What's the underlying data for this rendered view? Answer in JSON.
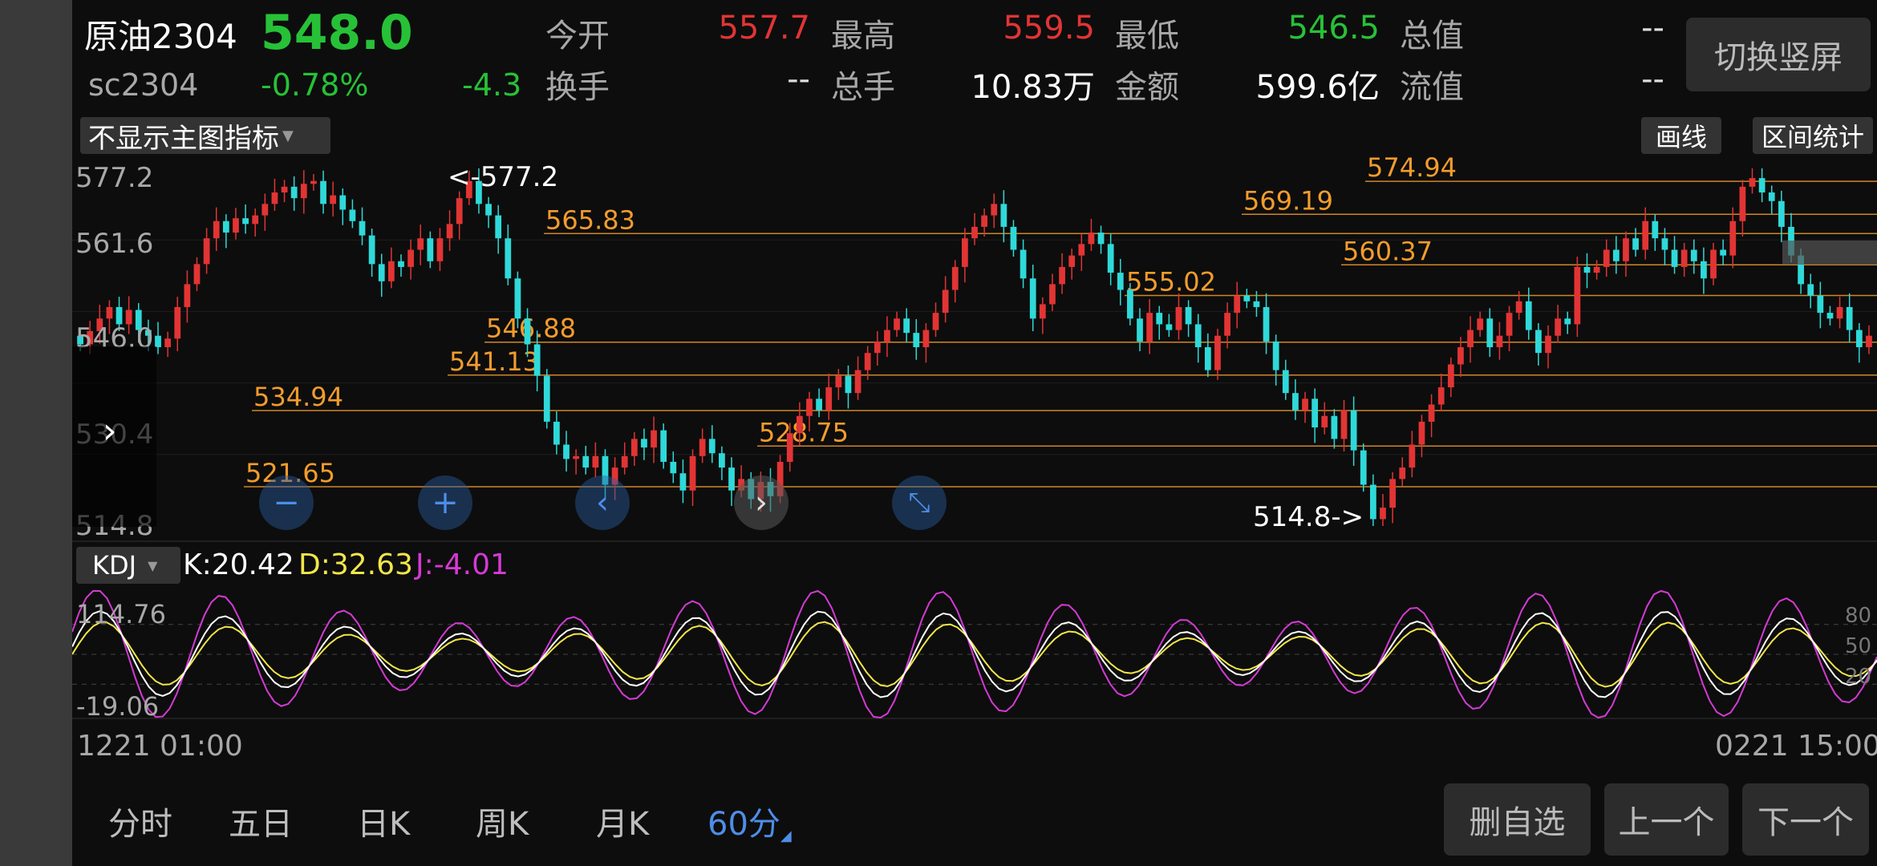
{
  "quote": {
    "name": "原油2304",
    "code": "sc2304",
    "price": "548.0",
    "change_pct": "-0.78%",
    "change": "-4.3",
    "fields": [
      {
        "label": "今开",
        "value": "557.7",
        "color": "#e23434"
      },
      {
        "label": "最高",
        "value": "559.5",
        "color": "#e23434"
      },
      {
        "label": "最低",
        "value": "546.5",
        "color": "#27c137"
      },
      {
        "label": "总值",
        "value": "--",
        "color": "#dddddd"
      },
      {
        "label": "换手",
        "value": "--",
        "color": "#dddddd"
      },
      {
        "label": "总手",
        "value": "10.83万",
        "color": "#ffffff"
      },
      {
        "label": "金额",
        "value": "599.6亿",
        "color": "#ffffff"
      },
      {
        "label": "流值",
        "value": "--",
        "color": "#dddddd"
      }
    ],
    "switch_label": "切换竖屏"
  },
  "toolbar": {
    "indicator_select": "不显示主图指标",
    "draw_line": "画线",
    "range_stats": "区间统计"
  },
  "main_chart": {
    "y_ticks": [
      "577.2",
      "561.6",
      "546.0",
      "530.4",
      "514.8"
    ],
    "high_marker": "<-577.2",
    "low_marker": "514.8->",
    "levels": [
      "574.94",
      "569.19",
      "565.83",
      "560.37",
      "555.02",
      "546.88",
      "541.13",
      "534.94",
      "528.75",
      "521.65"
    ]
  },
  "kdj": {
    "select": "KDJ",
    "k": "K:20.42",
    "d": "D:32.63",
    "j": "J:-4.01",
    "y_top": "114.76",
    "y_bottom": "-19.06",
    "right_ticks": [
      "80",
      "50",
      "20"
    ]
  },
  "time_axis": {
    "start": "1221 01:00",
    "end": "0221 15:00"
  },
  "tabs": [
    "分时",
    "五日",
    "日K",
    "周K",
    "月K",
    "60分"
  ],
  "actions": {
    "delete": "删自选",
    "prev": "上一个",
    "next": "下一个"
  },
  "colors": {
    "up": "#e23434",
    "down": "#2fd9d9",
    "level": "#f39c2c",
    "k": "#ffffff",
    "d": "#f2e64a",
    "j": "#d43ad4",
    "accent": "#4d8ee6"
  },
  "chart_data": {
    "type": "candlestick",
    "ylim": [
      514.8,
      577.2
    ],
    "closes": [
      546.5,
      548.8,
      551.0,
      553.0,
      550.0,
      552.5,
      549.0,
      548.0,
      546.0,
      547.5,
      553.0,
      557.0,
      560.5,
      565.0,
      568.0,
      566.0,
      568.5,
      567.5,
      569.0,
      571.0,
      573.0,
      574.0,
      572.0,
      574.5,
      575.0,
      571.0,
      572.5,
      570.0,
      568.0,
      565.5,
      560.5,
      557.5,
      561.0,
      560.0,
      563.0,
      565.0,
      561.0,
      565.0,
      567.5,
      572.0,
      575.0,
      571.0,
      569.0,
      565.0,
      558.0,
      551.0,
      546.5,
      541.0,
      533.0,
      529.0,
      526.5,
      527.0,
      525.0,
      527.0,
      522.0,
      525.0,
      527.0,
      530.0,
      528.5,
      531.5,
      526.0,
      524.0,
      521.0,
      527.0,
      530.0,
      527.5,
      525.0,
      521.0,
      523.0,
      519.5,
      522.5,
      520.0,
      526.0,
      531.0,
      534.0,
      537.0,
      535.0,
      539.0,
      541.0,
      538.0,
      542.0,
      545.0,
      547.0,
      549.0,
      551.0,
      548.5,
      546.0,
      549.0,
      552.0,
      556.0,
      560.0,
      565.0,
      567.0,
      569.0,
      571.0,
      567.0,
      563.0,
      558.0,
      551.0,
      553.5,
      557.0,
      560.0,
      562.0,
      564.0,
      566.0,
      564.0,
      559.0,
      556.0,
      551.0,
      547.0,
      552.0,
      550.0,
      549.0,
      553.0,
      550.0,
      546.0,
      542.0,
      548.0,
      552.0,
      555.0,
      554.0,
      553.0,
      547.0,
      542.0,
      538.0,
      535.0,
      537.0,
      532.0,
      534.0,
      530.0,
      535.0,
      528.0,
      522.0,
      516.0,
      518.0,
      523.0,
      525.0,
      529.0,
      533.0,
      536.0,
      539.0,
      543.0,
      546.0,
      549.0,
      551.0,
      546.0,
      548.0,
      552.0,
      554.0,
      549.0,
      545.0,
      548.0,
      551.0,
      550.0,
      560.0,
      559.0,
      560.0,
      563.0,
      561.0,
      565.0,
      563.0,
      568.0,
      565.0,
      563.0,
      560.0,
      563.0,
      561.0,
      558.0,
      563.0,
      562.0,
      568.0,
      574.0,
      575.5,
      573.0,
      571.5,
      567.0,
      562.0,
      557.0,
      555.0,
      552.0,
      551.0,
      553.0,
      549.0,
      546.0,
      548.0
    ]
  }
}
